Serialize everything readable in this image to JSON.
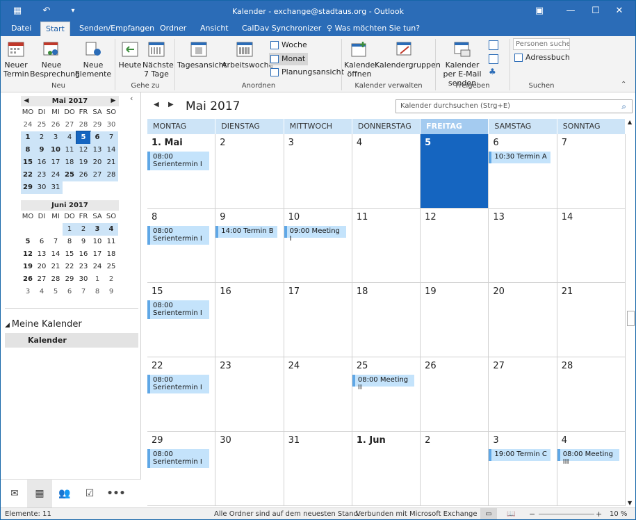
{
  "window": {
    "title": "Kalender - exchange@stadtaus.org - Outlook"
  },
  "tabs": [
    {
      "label": "Datei"
    },
    {
      "label": "Start"
    },
    {
      "label": "Senden/Empfangen"
    },
    {
      "label": "Ordner"
    },
    {
      "label": "Ansicht"
    },
    {
      "label": "CalDav Synchronizer"
    },
    {
      "label": "Was möchten Sie tun?"
    }
  ],
  "ribbon": {
    "neuer_termin": "Neuer Termin",
    "neue_besprechung": "Neue Besprechung",
    "neue_elemente": "Neue Elemente",
    "heute": "Heute",
    "naechste_7": "Nächste 7 Tage",
    "tagesansicht": "Tagesansicht",
    "arbeitswoche": "Arbeitswoche",
    "woche": "Woche",
    "monat": "Monat",
    "planungsansicht": "Planungsansicht",
    "kalender_oeffnen": "Kalender öffnen",
    "kalendergruppen": "Kalendergruppen",
    "kalender_email": "Kalender per E-Mail senden",
    "personen_suchen": "Personen suchen",
    "adressbuch": "Adressbuch",
    "groups": {
      "neu": "Neu",
      "gehe_zu": "Gehe zu",
      "anordnen": "Anordnen",
      "kalender_verwalten": "Kalender verwalten",
      "freigeben": "Freigeben",
      "suchen": "Suchen"
    }
  },
  "mini_may": {
    "title": "Mai 2017",
    "dow": [
      "MO",
      "DI",
      "MI",
      "DO",
      "FR",
      "SA",
      "SO"
    ],
    "weeks": [
      [
        {
          "d": "24",
          "c": "other"
        },
        {
          "d": "25",
          "c": "other"
        },
        {
          "d": "26",
          "c": "other"
        },
        {
          "d": "27",
          "c": "other"
        },
        {
          "d": "28",
          "c": "other"
        },
        {
          "d": "29",
          "c": "other"
        },
        {
          "d": "30",
          "c": "other"
        }
      ],
      [
        {
          "d": "1",
          "c": "hl b"
        },
        {
          "d": "2",
          "c": "hl"
        },
        {
          "d": "3",
          "c": "hl"
        },
        {
          "d": "4",
          "c": "hl"
        },
        {
          "d": "5",
          "c": "today"
        },
        {
          "d": "6",
          "c": "hl b"
        },
        {
          "d": "7",
          "c": "hl"
        }
      ],
      [
        {
          "d": "8",
          "c": "hl b"
        },
        {
          "d": "9",
          "c": "hl b"
        },
        {
          "d": "10",
          "c": "hl b"
        },
        {
          "d": "11",
          "c": "hl"
        },
        {
          "d": "12",
          "c": "hl"
        },
        {
          "d": "13",
          "c": "hl"
        },
        {
          "d": "14",
          "c": "hl"
        }
      ],
      [
        {
          "d": "15",
          "c": "hl b"
        },
        {
          "d": "16",
          "c": "hl"
        },
        {
          "d": "17",
          "c": "hl"
        },
        {
          "d": "18",
          "c": "hl"
        },
        {
          "d": "19",
          "c": "hl"
        },
        {
          "d": "20",
          "c": "hl"
        },
        {
          "d": "21",
          "c": "hl"
        }
      ],
      [
        {
          "d": "22",
          "c": "hl b"
        },
        {
          "d": "23",
          "c": "hl"
        },
        {
          "d": "24",
          "c": "hl"
        },
        {
          "d": "25",
          "c": "hl b"
        },
        {
          "d": "26",
          "c": "hl"
        },
        {
          "d": "27",
          "c": "hl"
        },
        {
          "d": "28",
          "c": "hl"
        }
      ],
      [
        {
          "d": "29",
          "c": "hl b"
        },
        {
          "d": "30",
          "c": "hl"
        },
        {
          "d": "31",
          "c": "hl"
        },
        {
          "d": "",
          "c": ""
        },
        {
          "d": "",
          "c": ""
        },
        {
          "d": "",
          "c": ""
        },
        {
          "d": "",
          "c": ""
        }
      ]
    ]
  },
  "mini_june": {
    "title": "Juni 2017",
    "dow": [
      "MO",
      "DI",
      "MI",
      "DO",
      "FR",
      "SA",
      "SO"
    ],
    "weeks": [
      [
        {
          "d": "",
          "c": ""
        },
        {
          "d": "",
          "c": ""
        },
        {
          "d": "",
          "c": ""
        },
        {
          "d": "1",
          "c": "hl"
        },
        {
          "d": "2",
          "c": "hl"
        },
        {
          "d": "3",
          "c": "hl b"
        },
        {
          "d": "4",
          "c": "hl b"
        }
      ],
      [
        {
          "d": "5",
          "c": "b"
        },
        {
          "d": "6",
          "c": ""
        },
        {
          "d": "7",
          "c": ""
        },
        {
          "d": "8",
          "c": ""
        },
        {
          "d": "9",
          "c": ""
        },
        {
          "d": "10",
          "c": ""
        },
        {
          "d": "11",
          "c": ""
        }
      ],
      [
        {
          "d": "12",
          "c": "b"
        },
        {
          "d": "13",
          "c": ""
        },
        {
          "d": "14",
          "c": ""
        },
        {
          "d": "15",
          "c": ""
        },
        {
          "d": "16",
          "c": ""
        },
        {
          "d": "17",
          "c": ""
        },
        {
          "d": "18",
          "c": ""
        }
      ],
      [
        {
          "d": "19",
          "c": "b"
        },
        {
          "d": "20",
          "c": ""
        },
        {
          "d": "21",
          "c": ""
        },
        {
          "d": "22",
          "c": ""
        },
        {
          "d": "23",
          "c": ""
        },
        {
          "d": "24",
          "c": ""
        },
        {
          "d": "25",
          "c": ""
        }
      ],
      [
        {
          "d": "26",
          "c": "b"
        },
        {
          "d": "27",
          "c": ""
        },
        {
          "d": "28",
          "c": ""
        },
        {
          "d": "29",
          "c": ""
        },
        {
          "d": "30",
          "c": ""
        },
        {
          "d": "1",
          "c": "other"
        },
        {
          "d": "2",
          "c": "other"
        }
      ],
      [
        {
          "d": "3",
          "c": "other"
        },
        {
          "d": "4",
          "c": "other"
        },
        {
          "d": "5",
          "c": "other"
        },
        {
          "d": "6",
          "c": "other"
        },
        {
          "d": "7",
          "c": "other"
        },
        {
          "d": "8",
          "c": "other"
        },
        {
          "d": "9",
          "c": "other"
        }
      ]
    ]
  },
  "sidebar": {
    "group": "Meine Kalender",
    "calendar": "Kalender"
  },
  "main": {
    "month_title": "Mai 2017",
    "search_placeholder": "Kalender durchsuchen (Strg+E)",
    "dow": [
      "MONTAG",
      "DIENSTAG",
      "MITTWOCH",
      "DONNERSTAG",
      "FREITAG",
      "SAMSTAG",
      "SONNTAG"
    ],
    "weeks": [
      [
        {
          "n": "1. Mai",
          "b": true,
          "ev": [
            "08:00",
            "Serientermin I"
          ]
        },
        {
          "n": "2"
        },
        {
          "n": "3"
        },
        {
          "n": "4"
        },
        {
          "n": "5",
          "today": true,
          "b": true
        },
        {
          "n": "6",
          "ev": [
            "10:30 Termin A"
          ]
        },
        {
          "n": "7"
        }
      ],
      [
        {
          "n": "8",
          "ev": [
            "08:00",
            "Serientermin I"
          ]
        },
        {
          "n": "9",
          "ev": [
            "14:00 Termin B"
          ]
        },
        {
          "n": "10",
          "ev": [
            "09:00 Meeting I"
          ]
        },
        {
          "n": "11"
        },
        {
          "n": "12"
        },
        {
          "n": "13"
        },
        {
          "n": "14"
        }
      ],
      [
        {
          "n": "15",
          "ev": [
            "08:00",
            "Serientermin I"
          ]
        },
        {
          "n": "16"
        },
        {
          "n": "17"
        },
        {
          "n": "18"
        },
        {
          "n": "19"
        },
        {
          "n": "20"
        },
        {
          "n": "21"
        }
      ],
      [
        {
          "n": "22",
          "ev": [
            "08:00",
            "Serientermin I"
          ]
        },
        {
          "n": "23"
        },
        {
          "n": "24"
        },
        {
          "n": "25",
          "ev": [
            "08:00 Meeting II"
          ]
        },
        {
          "n": "26"
        },
        {
          "n": "27"
        },
        {
          "n": "28"
        }
      ],
      [
        {
          "n": "29",
          "ev": [
            "08:00",
            "Serientermin I"
          ]
        },
        {
          "n": "30"
        },
        {
          "n": "31"
        },
        {
          "n": "1. Jun",
          "b": true
        },
        {
          "n": "2"
        },
        {
          "n": "3",
          "ev": [
            "19:00 Termin C"
          ]
        },
        {
          "n": "4",
          "ev": [
            "08:00 Meeting III"
          ]
        }
      ]
    ]
  },
  "status": {
    "elements": "Elemente: 11",
    "folders": "Alle Ordner sind auf dem neuesten Stand.",
    "connection": "Verbunden mit Microsoft Exchange",
    "zoom": "10 %"
  }
}
